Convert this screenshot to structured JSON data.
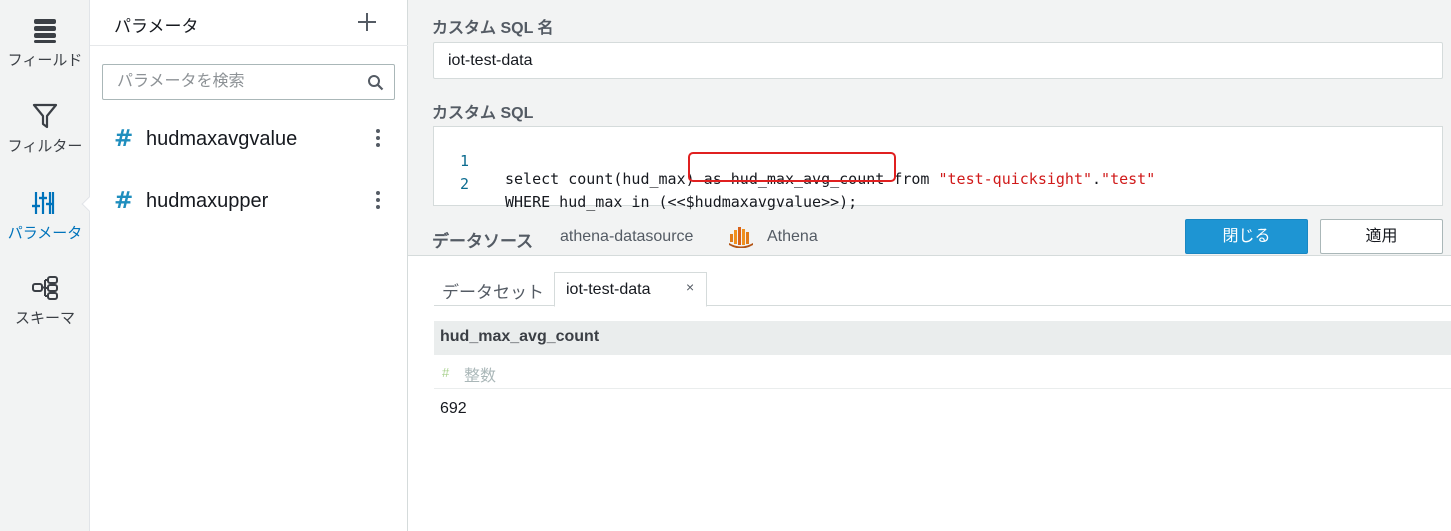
{
  "rail": {
    "items": [
      {
        "label": "フィールド",
        "icon": "database-icon"
      },
      {
        "label": "フィルター",
        "icon": "filter-icon"
      },
      {
        "label": "パラメータ",
        "icon": "sliders-icon",
        "active": true
      },
      {
        "label": "スキーマ",
        "icon": "schema-icon"
      }
    ]
  },
  "params_panel": {
    "title": "パラメータ",
    "search_placeholder": "パラメータを検索",
    "parameters": [
      {
        "type_icon": "#",
        "name": "hudmaxavgvalue"
      },
      {
        "type_icon": "#",
        "name": "hudmaxupper"
      }
    ]
  },
  "editor": {
    "name_label": "カスタム SQL 名",
    "name_value": "iot-test-data",
    "sql_label": "カスタム SQL",
    "sql_lines": [
      {
        "num": "1",
        "before": "select count(hud_max) as hud_max_avg_count from ",
        "str1": "\"test-quicksight\"",
        "dot": ".",
        "str2": "\"test\""
      },
      {
        "num": "2",
        "text": "WHERE hud_max in (<<$hudmaxavgvalue>>);"
      }
    ],
    "datasource_label": "データソース",
    "datasource_name": "athena-datasource",
    "datasource_type": "Athena",
    "close_button": "閉じる",
    "apply_button": "適用"
  },
  "results": {
    "tab_static": "データセット",
    "tab_active": "iot-test-data",
    "tab_close": "×",
    "columns": [
      {
        "name": "hud_max_avg_count",
        "type_icon": "#",
        "type": "整数"
      }
    ],
    "rows": [
      [
        "692"
      ]
    ]
  },
  "colors": {
    "accent": "#1e95d3",
    "active_text": "#0073bb",
    "highlight": "#e02020",
    "sql_string": "#d01a1a"
  }
}
